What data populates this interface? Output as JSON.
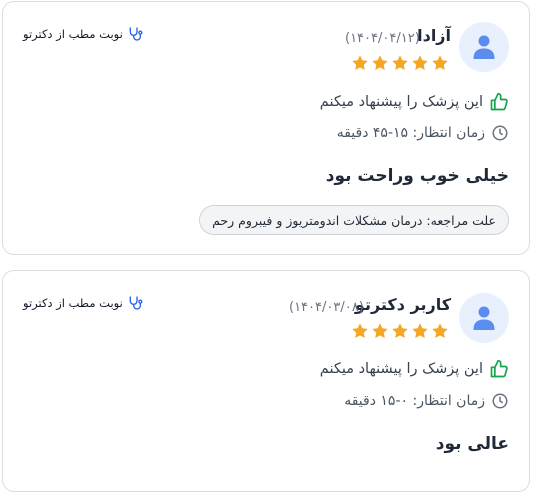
{
  "reviews": [
    {
      "name": "آزادا",
      "date": "(۱۴۰۴/۰۴/۱۲)",
      "stars": 5,
      "booked_label": "نوبت مطب از دکترتو",
      "recommend": "این پزشک را پیشنهاد میکنم",
      "wait": "زمان انتظار: ۱۵-۴۵ دقیقه",
      "comment": "خیلی خوب وراحت بود",
      "reason": "علت مراجعه: درمان مشکلات اندومتریوز و فیبروم رحم"
    },
    {
      "name": "کاربر دکترتو",
      "date": "(۱۴۰۴/۰۳/۰۸)",
      "stars": 5,
      "booked_label": "نوبت مطب از دکترتو",
      "recommend": "این پزشک را پیشنهاد میکنم",
      "wait": "زمان انتظار: ۰-۱۵ دقیقه",
      "comment": "عالی بود"
    }
  ],
  "colors": {
    "star": "#f5a623",
    "thumb": "#16a34a",
    "stethoscope": "#2563eb",
    "avatar_bg": "#e8f0fd",
    "avatar_fg": "#5b8def"
  },
  "icons": {
    "avatar": "user-icon",
    "star": "star-icon",
    "recommend": "thumbs-up-icon",
    "wait": "clock-icon",
    "booked": "stethoscope-icon"
  }
}
